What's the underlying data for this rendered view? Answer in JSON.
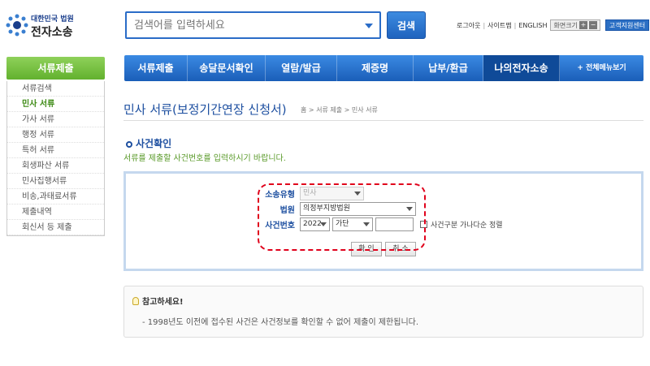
{
  "header": {
    "logo_org": "대한민국 법원",
    "logo_name": "전자소송",
    "search_placeholder": "검색어를 입력하세요",
    "search_button": "검색",
    "util_links": [
      "로그아웃",
      "사이트맵",
      "ENGLISH"
    ],
    "font_size_label": "화면크기",
    "font_plus": "+",
    "font_minus": "−",
    "help_center": "고객지원센터"
  },
  "sidebar": {
    "title": "서류제출",
    "items": [
      {
        "label": "서류검색",
        "active": false
      },
      {
        "label": "민사 서류",
        "active": true
      },
      {
        "label": "가사 서류",
        "active": false
      },
      {
        "label": "행정 서류",
        "active": false
      },
      {
        "label": "특허 서류",
        "active": false
      },
      {
        "label": "회생파산 서류",
        "active": false
      },
      {
        "label": "민사집행서류",
        "active": false
      },
      {
        "label": "비송,과태료서류",
        "active": false
      },
      {
        "label": "제출내역",
        "active": false
      },
      {
        "label": "회신서 등 제출",
        "active": false
      }
    ]
  },
  "gnb": {
    "items": [
      "서류제출",
      "송달문서확인",
      "열람/발급",
      "제증명",
      "납부/환급",
      "나의전자소송"
    ],
    "current_index": 5,
    "all_menu": "+ 전체메뉴보기"
  },
  "page": {
    "title": "민사 서류(보정기간연장 신청서)",
    "breadcrumb": "홈 > 서류 제출 > 민사 서류"
  },
  "section": {
    "title": "사건확인",
    "desc": "서류를 제출할 사건번호를 입력하시기 바랍니다."
  },
  "form": {
    "case_type_label": "소송유형",
    "case_type_value": "민사",
    "court_label": "법원",
    "court_value": "의정부지방법원",
    "case_no_label": "사건번호",
    "year_value": "2022",
    "case_code_value": "가단",
    "case_number_value": "",
    "sort_checkbox_label": "사건구분 가나다순 정렬",
    "confirm_button": "확 인",
    "cancel_button": "취 소"
  },
  "note": {
    "title": "참고하세요!",
    "text": "- 1998년도 이전에 접수된 사건은 사건정보를 확인할 수 없어 제출이 제한됩니다."
  },
  "colors": {
    "brand_blue": "#1d4fa0",
    "nav_green": "#62b12e",
    "highlight_red": "#e0001b"
  }
}
